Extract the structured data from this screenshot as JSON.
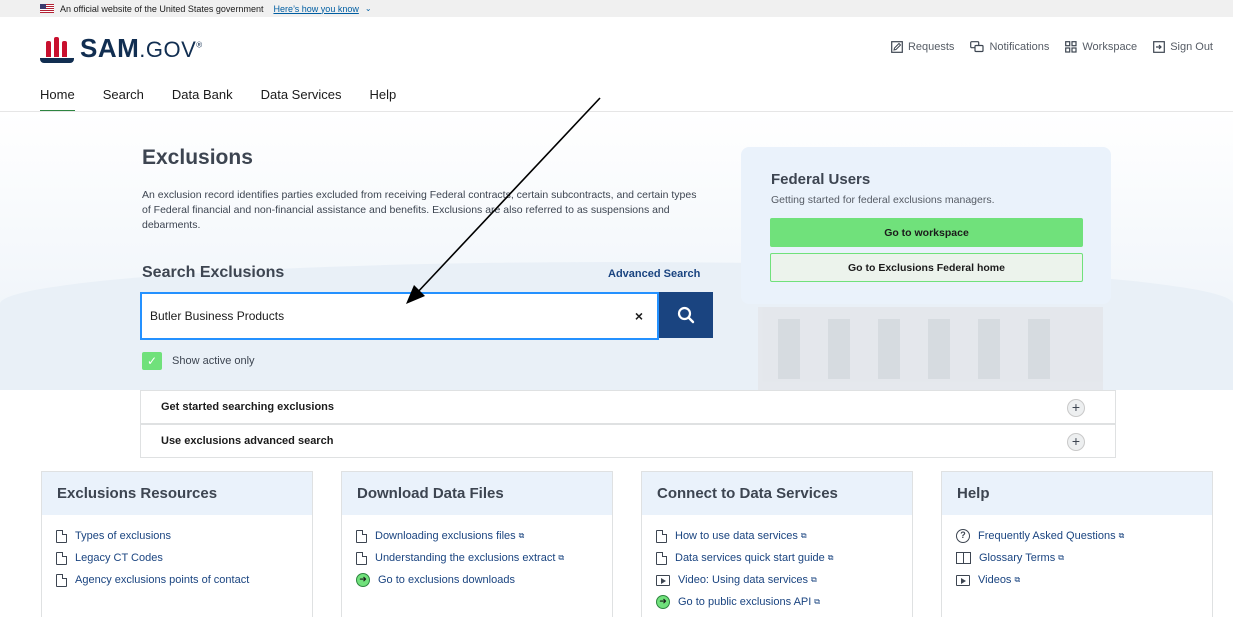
{
  "gov_banner": {
    "text": "An official website of the United States government",
    "link": "Here’s how you know"
  },
  "header": {
    "logo_text": "SAM",
    "logo_suffix": ".GOV",
    "util_nav": [
      {
        "label": "Requests",
        "icon": "edit-icon"
      },
      {
        "label": "Notifications",
        "icon": "chat-icon"
      },
      {
        "label": "Workspace",
        "icon": "grid-icon"
      },
      {
        "label": "Sign Out",
        "icon": "sign-out-icon"
      }
    ]
  },
  "main_nav": [
    {
      "label": "Home",
      "active": true
    },
    {
      "label": "Search"
    },
    {
      "label": "Data Bank"
    },
    {
      "label": "Data Services"
    },
    {
      "label": "Help"
    }
  ],
  "hero": {
    "title": "Exclusions",
    "description": "An exclusion record identifies parties excluded from receiving Federal contracts, certain subcontracts, and certain types of Federal financial and non-financial assistance and benefits. Exclusions are also referred to as suspensions and debarments."
  },
  "search": {
    "title": "Search Exclusions",
    "advanced_link": "Advanced Search",
    "value": "Butler Business Products",
    "clear_label": "×",
    "show_active_label": "Show active only"
  },
  "federal_users": {
    "title": "Federal Users",
    "subtitle": "Getting started for federal exclusions managers.",
    "button_workspace": "Go to workspace",
    "button_home": "Go to Exclusions Federal home"
  },
  "accordions": [
    {
      "label": "Get started searching exclusions"
    },
    {
      "label": "Use exclusions advanced search"
    }
  ],
  "cards": [
    {
      "title": "Exclusions Resources",
      "items": [
        {
          "label": "Types of exclusions",
          "icon": "document-icon"
        },
        {
          "label": "Legacy CT Codes",
          "icon": "document-icon"
        },
        {
          "label": "Agency exclusions points of contact",
          "icon": "document-icon"
        }
      ]
    },
    {
      "title": "Download Data Files",
      "items": [
        {
          "label": "Downloading exclusions files",
          "icon": "document-icon"
        },
        {
          "label": "Understanding the exclusions extract",
          "icon": "document-icon"
        },
        {
          "label": "Go to exclusions downloads",
          "icon": "arrow-circle-icon"
        }
      ]
    },
    {
      "title": "Connect to Data Services",
      "items": [
        {
          "label": "How to use data services",
          "icon": "document-icon"
        },
        {
          "label": "Data services quick start guide",
          "icon": "document-icon"
        },
        {
          "label": "Video: Using data services",
          "icon": "video-icon"
        },
        {
          "label": "Go to public exclusions API",
          "icon": "arrow-circle-icon"
        }
      ]
    },
    {
      "title": "Help",
      "items": [
        {
          "label": "Frequently Asked Questions",
          "icon": "question-icon"
        },
        {
          "label": "Glossary Terms",
          "icon": "book-icon"
        },
        {
          "label": "Videos",
          "icon": "video-icon"
        }
      ]
    }
  ],
  "colors": {
    "brand_navy": "#112e51",
    "brand_red": "#c8102e",
    "primary_blue": "#1a4480",
    "focus_blue": "#2491ff",
    "accent_green": "#70e17b",
    "nav_active_green": "#2e8540"
  }
}
